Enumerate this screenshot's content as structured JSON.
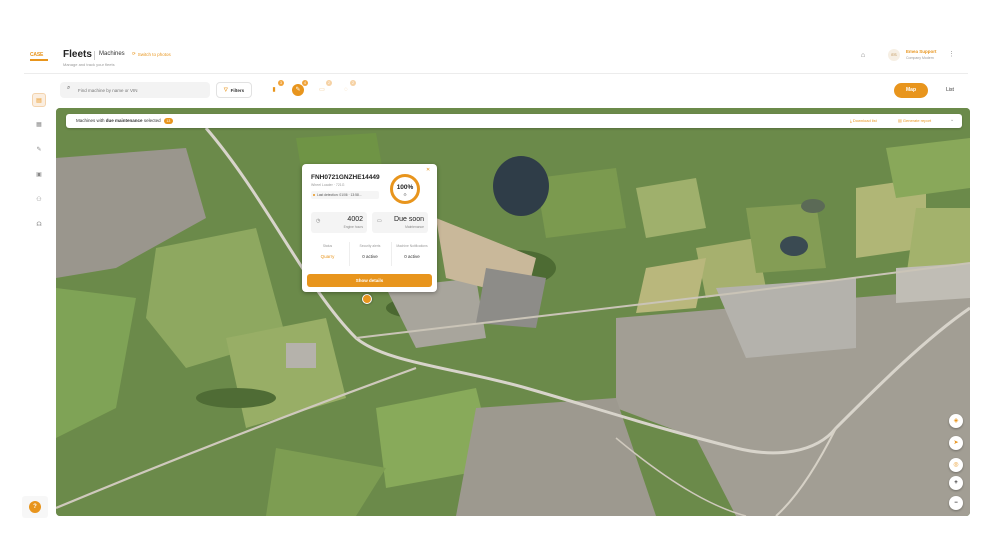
{
  "header": {
    "logo": "CASE",
    "title": "Fleets",
    "subtitle": "Machines",
    "switch_label": "Switch to photos",
    "caption": "Manage and track your fleets",
    "user_name": "Emea Support",
    "user_org": "Company Modern",
    "user_initials": "ES"
  },
  "toolbar": {
    "search_placeholder": "Find machine by name or VIN",
    "filters_label": "Filters",
    "status_badges": [
      "3",
      "4",
      "2",
      "2"
    ],
    "map_label": "Map",
    "list_label": "List"
  },
  "banner": {
    "prefix": "Machines with",
    "highlight": "due maintenance",
    "suffix": "selected",
    "count": "13",
    "download": "Download list",
    "report": "Generate report"
  },
  "card": {
    "vin": "FNH0721GNZHE14449",
    "model": "Wheel Loader · 721G",
    "location": "Last detection: 01/06 · 13:58...",
    "percent": "100%",
    "engine_hours_value": "4002",
    "engine_hours_label": "Engine hours",
    "maintenance_value": "Due soon",
    "maintenance_label": "Maintenance",
    "status_header": "Status",
    "status_value": "Quarry",
    "warning_header": "Security alerts",
    "warning_value": "0 active",
    "machine_header": "Machine Notifications",
    "machine_value": "0 active",
    "show_details": "Show details"
  },
  "colors": {
    "accent": "#e8951d"
  }
}
